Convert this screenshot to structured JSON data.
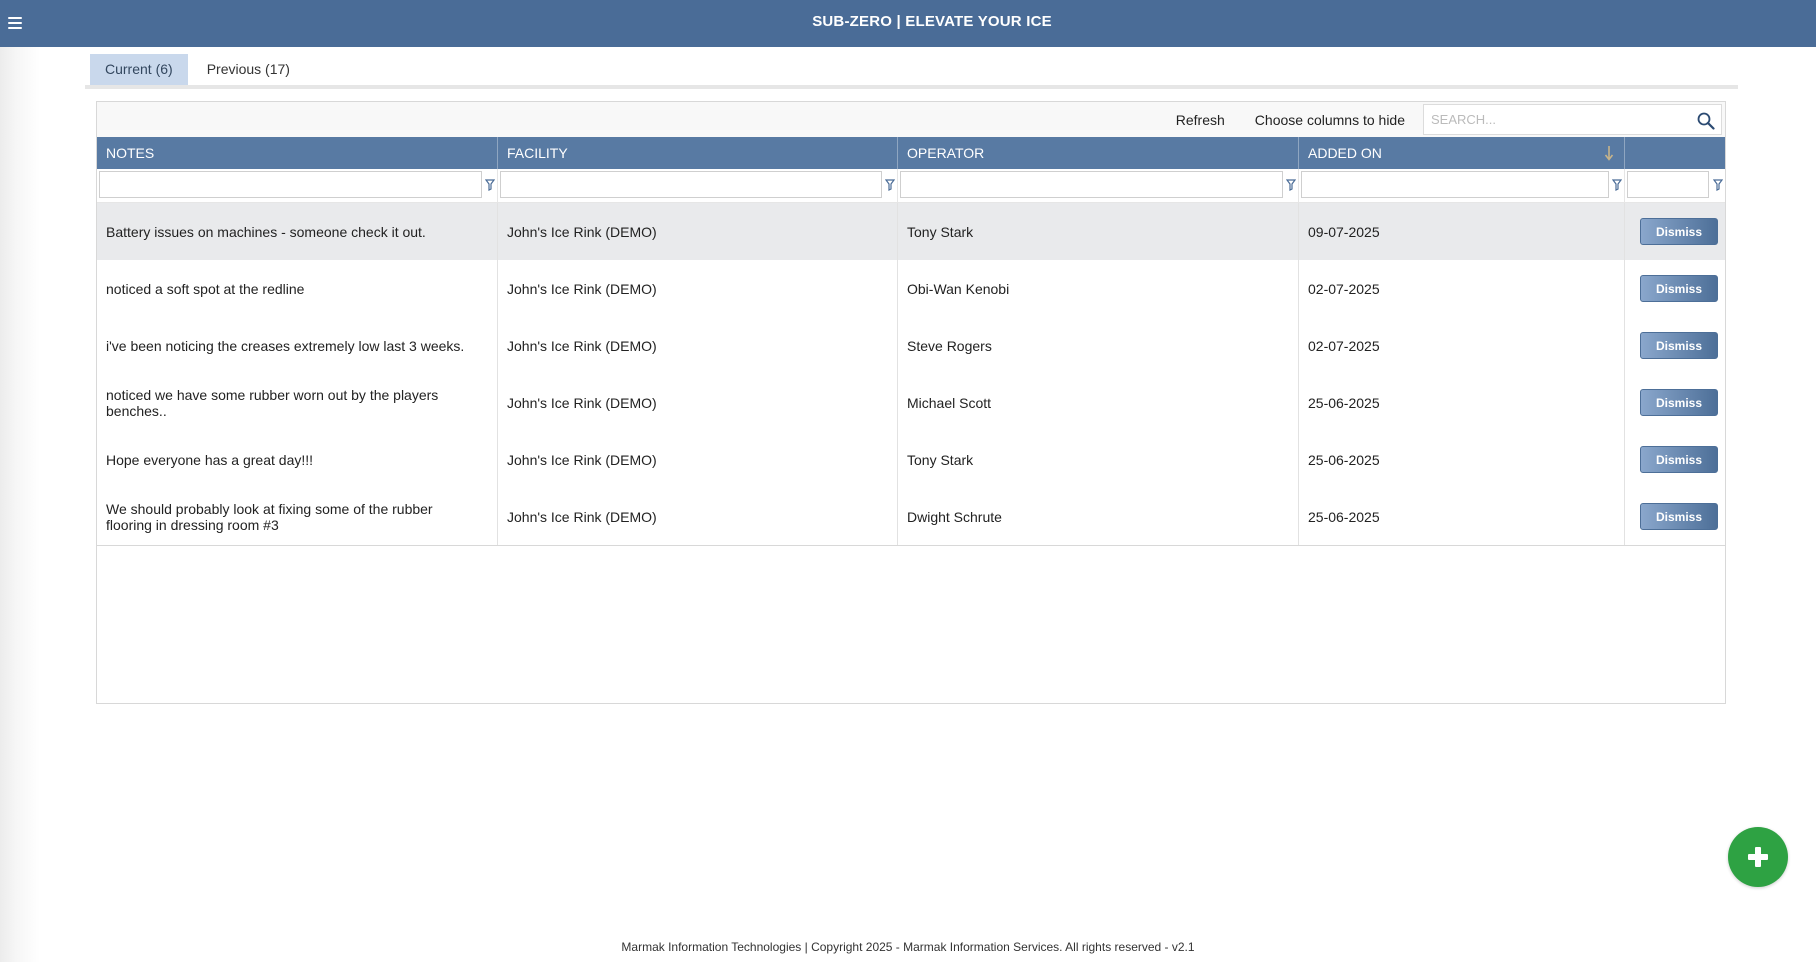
{
  "header": {
    "title": "SUB-ZERO | ELEVATE YOUR ICE",
    "menu_icon": "hamburger-menu-icon"
  },
  "tabs": [
    {
      "label": "Current (6)",
      "active": true
    },
    {
      "label": "Previous (17)",
      "active": false
    }
  ],
  "toolbar": {
    "refresh_label": "Refresh",
    "choose_columns_label": "Choose columns to hide",
    "search_placeholder": "SEARCH...",
    "search_value": ""
  },
  "table": {
    "columns": [
      "NOTES",
      "FACILITY",
      "OPERATOR",
      "ADDED ON",
      ""
    ],
    "sorted_column": "ADDED ON",
    "sort_direction": "descending",
    "rows": [
      {
        "notes": "Battery issues on machines - someone check it out.",
        "facility": "John's Ice Rink (DEMO)",
        "operator": "Tony Stark",
        "added_on": "09-07-2025",
        "action": "Dismiss"
      },
      {
        "notes": "noticed a soft spot at the redline",
        "facility": "John's Ice Rink (DEMO)",
        "operator": "Obi-Wan Kenobi",
        "added_on": "02-07-2025",
        "action": "Dismiss"
      },
      {
        "notes": "i've been noticing the creases extremely low last 3 weeks.",
        "facility": "John's Ice Rink (DEMO)",
        "operator": "Steve Rogers",
        "added_on": "02-07-2025",
        "action": "Dismiss"
      },
      {
        "notes": "noticed we have some rubber worn out by the players benches..",
        "facility": "John's Ice Rink (DEMO)",
        "operator": "Michael Scott",
        "added_on": "25-06-2025",
        "action": "Dismiss"
      },
      {
        "notes": "Hope everyone has a great day!!!",
        "facility": "John's Ice Rink (DEMO)",
        "operator": "Tony Stark",
        "added_on": "25-06-2025",
        "action": "Dismiss"
      },
      {
        "notes": "We should probably look at fixing some of the rubber flooring in dressing room #3",
        "facility": "John's Ice Rink (DEMO)",
        "operator": "Dwight Schrute",
        "added_on": "25-06-2025",
        "action": "Dismiss"
      }
    ]
  },
  "fab": {
    "icon": "plus-icon"
  },
  "footer": {
    "text": "Marmak Information Technologies | Copyright 2025 - Marmak Information Services. All rights reserved - v2.1"
  },
  "colors": {
    "header_bg": "#4a6c97",
    "table_header_bg": "#587aa3",
    "tab_active_bg": "#c9d8ec",
    "fab_bg": "#2ea243"
  }
}
